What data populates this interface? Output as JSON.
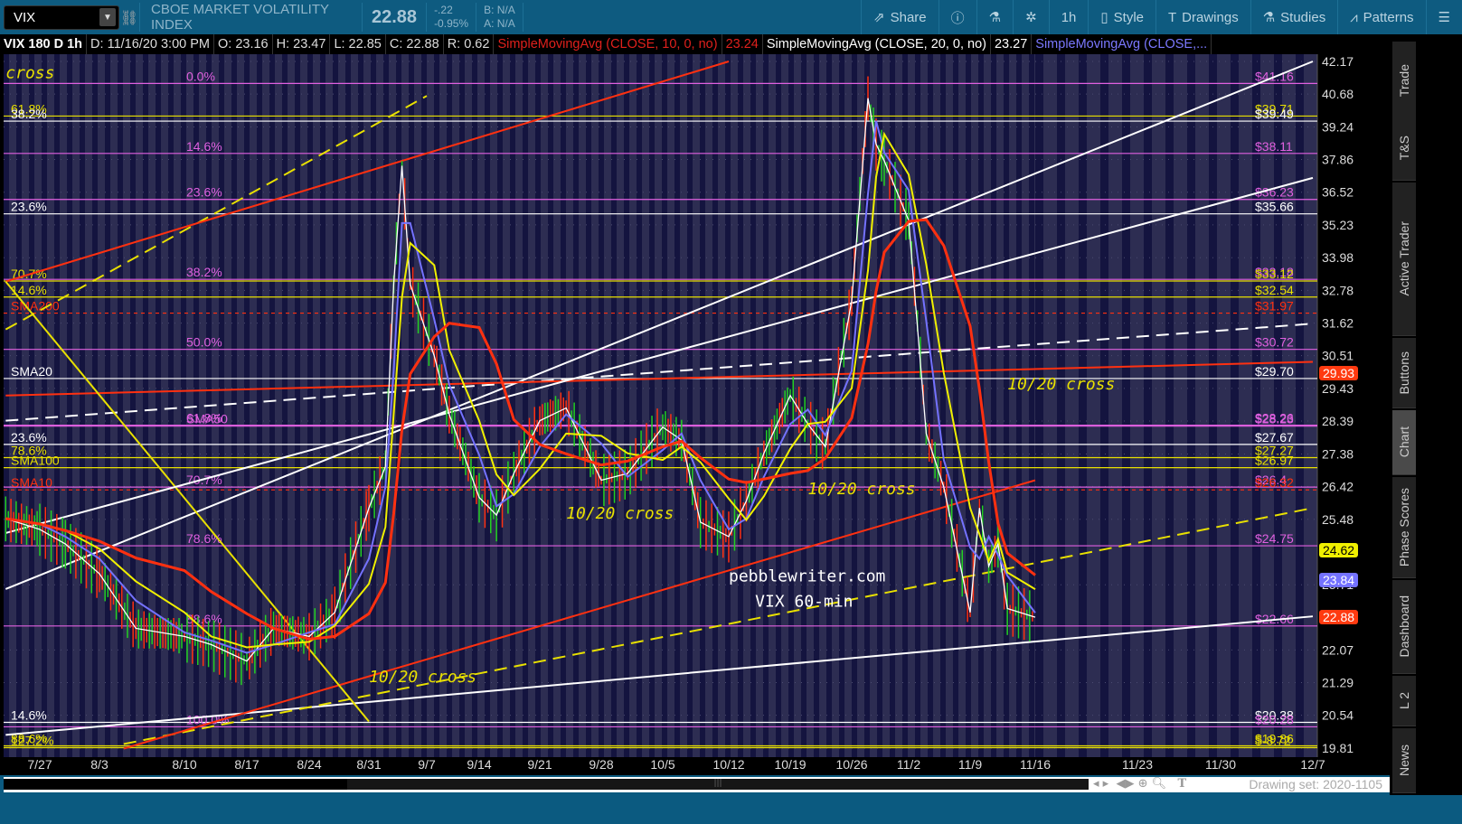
{
  "toolbar": {
    "symbol": "VIX",
    "description": "CBOE MARKET VOLATILITY INDEX",
    "last": "22.88",
    "change": "-.22",
    "change_pct": "-0.95%",
    "bid": "B: N/A",
    "ask": "A: N/A",
    "buttons": [
      {
        "label": "Share",
        "icon": "share-icon"
      },
      {
        "label": "",
        "icon": "info-icon"
      },
      {
        "label": "",
        "icon": "flask-icon"
      },
      {
        "label": "",
        "icon": "gear-icon"
      },
      {
        "label": "1h",
        "icon": ""
      },
      {
        "label": "Style",
        "icon": "candle-icon"
      },
      {
        "label": "Drawings",
        "icon": "text-tool-icon"
      },
      {
        "label": "Studies",
        "icon": "flask-icon"
      },
      {
        "label": "Patterns",
        "icon": "patterns-icon"
      },
      {
        "label": "",
        "icon": "menu-icon"
      }
    ]
  },
  "header": {
    "title": "VIX 180 D 1h",
    "date": "D: 11/16/20 3:00 PM",
    "open": "O: 23.16",
    "high": "H: 23.47",
    "low": "L: 22.85",
    "close": "C: 22.88",
    "range": "R: 0.62",
    "studies": [
      {
        "name": "SimpleMovingAvg (CLOSE, 10, 0, no)",
        "value": "23.24",
        "color": "#e0201c"
      },
      {
        "name": "SimpleMovingAvg (CLOSE, 20, 0, no)",
        "value": "23.27",
        "color": "#ffffff"
      },
      {
        "name": "SimpleMovingAvg (CLOSE,...",
        "value": "",
        "color": "#7b78ff"
      }
    ]
  },
  "chart_data": {
    "type": "line",
    "scale": "log",
    "ylim": [
      19.81,
      42.17
    ],
    "yticks": [
      "42.17",
      "40.68",
      "39.24",
      "37.86",
      "36.52",
      "35.23",
      "33.98",
      "32.78",
      "31.62",
      "30.51",
      "29.43",
      "28.39",
      "27.38",
      "26.42",
      "25.48",
      "23.71",
      "22.07",
      "21.29",
      "20.54",
      "19.81"
    ],
    "xticks": [
      "7/27",
      "8/3",
      "8/10",
      "8/17",
      "8/24",
      "8/31",
      "9/7",
      "9/14",
      "9/21",
      "9/28",
      "10/5",
      "10/12",
      "10/19",
      "10/26",
      "11/2",
      "11/9",
      "11/16",
      "11/23",
      "11/30",
      "12/7"
    ],
    "price": [
      [
        "7/23",
        25.5
      ],
      [
        "7/27",
        25.2
      ],
      [
        "7/30",
        24.8
      ],
      [
        "8/3",
        24
      ],
      [
        "8/6",
        22.6
      ],
      [
        "8/10",
        22.4
      ],
      [
        "8/13",
        22.2
      ],
      [
        "8/17",
        21.8
      ],
      [
        "8/20",
        22.6
      ],
      [
        "8/24",
        22.4
      ],
      [
        "8/27",
        23
      ],
      [
        "8/31",
        25.8
      ],
      [
        "9/2",
        27
      ],
      [
        "9/3",
        33
      ],
      [
        "9/4",
        37.6
      ],
      [
        "9/5",
        33
      ],
      [
        "9/8",
        30.5
      ],
      [
        "9/10",
        28.6
      ],
      [
        "9/14",
        26.1
      ],
      [
        "9/16",
        25.6
      ],
      [
        "9/18",
        26.8
      ],
      [
        "9/21",
        28.4
      ],
      [
        "9/24",
        28.8
      ],
      [
        "9/28",
        26.6
      ],
      [
        "10/1",
        26.8
      ],
      [
        "10/5",
        28.2
      ],
      [
        "10/7",
        27.8
      ],
      [
        "10/9",
        25.4
      ],
      [
        "10/12",
        25
      ],
      [
        "10/14",
        26
      ],
      [
        "10/16",
        27.4
      ],
      [
        "10/19",
        29.2
      ],
      [
        "10/21",
        28.3
      ],
      [
        "10/23",
        27.6
      ],
      [
        "10/26",
        32.4
      ],
      [
        "10/28",
        40.5
      ],
      [
        "10/29",
        38.5
      ],
      [
        "10/30",
        37.8
      ],
      [
        "11/2",
        35.4
      ],
      [
        "11/4",
        28
      ],
      [
        "11/6",
        26.4
      ],
      [
        "11/9",
        23
      ],
      [
        "11/10",
        25.8
      ],
      [
        "11/11",
        24.2
      ],
      [
        "11/12",
        24.8
      ],
      [
        "11/13",
        23.1
      ],
      [
        "11/16",
        22.88
      ]
    ],
    "levels": [
      {
        "price": 41.16,
        "label": "$41.16",
        "left": "0.0%",
        "color": "#e060e0"
      },
      {
        "price": 39.71,
        "label": "$39.71",
        "left": "61.8%",
        "color": "#e8e000"
      },
      {
        "price": 39.49,
        "label": "$39.49",
        "left": "38.2%",
        "color": "#ffffff"
      },
      {
        "price": 38.11,
        "label": "$38.11",
        "left": "14.6%",
        "color": "#e060e0"
      },
      {
        "price": 36.23,
        "label": "$36.23",
        "left": "23.6%",
        "color": "#e060e0"
      },
      {
        "price": 35.66,
        "label": "$35.66",
        "left": "23.6%",
        "color": "#ffffff"
      },
      {
        "price": 33.18,
        "label": "$33.18",
        "left": "38.2%",
        "color": "#e060e0"
      },
      {
        "price": 33.12,
        "label": "$33.12",
        "left": "70.7%",
        "color": "#e8e000"
      },
      {
        "price": 32.54,
        "label": "$32.54",
        "left": "14.6%",
        "color": "#e8e000"
      },
      {
        "price": 31.97,
        "label": "$31.97",
        "left": "SMA200",
        "color": "#ff3010"
      },
      {
        "price": 30.72,
        "label": "$30.72",
        "left": "50.0%",
        "color": "#e060e0"
      },
      {
        "price": 29.75,
        "label": "$29.70",
        "left": "SMA20",
        "color": "#ffffff"
      },
      {
        "price": 28.26,
        "label": "$28.26",
        "left": "61.8%",
        "color": "#e060e0"
      },
      {
        "price": 28.23,
        "label": "$28.23",
        "left": "SMA50",
        "color": "#e060e0"
      },
      {
        "price": 27.67,
        "label": "$27.67",
        "left": "23.6%",
        "color": "#ffffff"
      },
      {
        "price": 27.27,
        "label": "$27.27",
        "left": "78.6%",
        "color": "#e8e000"
      },
      {
        "price": 26.97,
        "label": "$26.97",
        "left": "SMA100",
        "color": "#e8e000"
      },
      {
        "price": 26.4,
        "label": "$26.4",
        "left": "70.7%",
        "color": "#e060e0"
      },
      {
        "price": 26.32,
        "label": "$26.32",
        "left": "SMA10",
        "color": "#ff3010"
      },
      {
        "price": 24.75,
        "label": "$24.75",
        "left": "78.6%",
        "color": "#e060e0"
      },
      {
        "price": 22.66,
        "label": "$22.66",
        "left": "88.6%",
        "color": "#e060e0"
      },
      {
        "price": 20.38,
        "label": "$20.38",
        "left": "14.6%",
        "color": "#ffffff"
      },
      {
        "price": 20.28,
        "label": "$20.28",
        "left": "100.0%",
        "color": "#e060e0"
      },
      {
        "price": 19.86,
        "label": "$19.86",
        "left": "88.6%",
        "color": "#e8e000"
      },
      {
        "price": 19.82,
        "label": "$-8.72",
        "left": "127.2%",
        "color": "#e8e000"
      }
    ],
    "trendlines": [
      {
        "from": [
          "7/23",
          23.6
        ],
        "to": [
          "12/7",
          42.17
        ],
        "color": "#ffffff",
        "dash": false
      },
      {
        "from": [
          "7/23",
          20.1
        ],
        "to": [
          "12/7",
          22.9
        ],
        "color": "#ffffff",
        "dash": false
      },
      {
        "from": [
          "7/23",
          28.4
        ],
        "to": [
          "12/7",
          31.6
        ],
        "color": "#ffffff",
        "dash": true
      },
      {
        "from": [
          "8/5",
          19.9
        ],
        "to": [
          "12/7",
          25.8
        ],
        "color": "#e8e000",
        "dash": true
      },
      {
        "from": [
          "7/23",
          31.4
        ],
        "to": [
          "9/7",
          40.6
        ],
        "color": "#e8e000",
        "dash": true
      },
      {
        "from": [
          "7/23",
          33.1
        ],
        "to": [
          "10/12",
          42.17
        ],
        "color": "#ff3010",
        "dash": false
      },
      {
        "from": [
          "8/5",
          19.8
        ],
        "to": [
          "11/16",
          26.6
        ],
        "color": "#ff3010",
        "dash": false
      },
      {
        "from": [
          "7/23",
          29.2
        ],
        "to": [
          "12/7",
          30.3
        ],
        "color": "#ff3010",
        "dash": false
      },
      {
        "from": [
          "7/23",
          33.1
        ],
        "to": [
          "8/31",
          20.4
        ],
        "color": "#e8e000",
        "dash": false
      },
      {
        "from": [
          "7/23",
          25.1
        ],
        "to": [
          "12/7",
          37.1
        ],
        "color": "#ffffff",
        "dash": false
      }
    ],
    "price_badges": [
      {
        "value": "29.93",
        "bg": "#ff3a10",
        "fg": "#ffffff"
      },
      {
        "value": "24.62",
        "bg": "#f0f000",
        "fg": "#000000"
      },
      {
        "value": "23.84",
        "bg": "#7472ff",
        "fg": "#ffffff"
      },
      {
        "value": "22.88",
        "bg": "#ff3a10",
        "fg": "#ffffff"
      }
    ],
    "annotations": [
      {
        "text": "10/20 cross",
        "at": [
          "8/31",
          21.3
        ],
        "color": "#e8e000"
      },
      {
        "text": "10/20 cross",
        "at": [
          "9/24",
          25.5
        ],
        "color": "#e8e000"
      },
      {
        "text": "10/20 cross",
        "at": [
          "10/21",
          26.2
        ],
        "color": "#e8e000"
      },
      {
        "text": "10/20 cross",
        "at": [
          "11/13",
          29.4
        ],
        "color": "#e8e000"
      },
      {
        "text": "pebblewriter.com",
        "at": [
          "10/12",
          23.8
        ],
        "color": "#ffffff"
      },
      {
        "text": "VIX 60-min",
        "at": [
          "10/15",
          23.15
        ],
        "color": "#ffffff"
      },
      {
        "text": "cross",
        "at": [
          "7/23",
          41.4
        ],
        "color": "#e8e000"
      }
    ]
  },
  "bottom": {
    "drawing_set": "Drawing set: 2020-1105"
  },
  "sidebar": {
    "tabs": [
      "Trade",
      "T&S",
      "Active Trader",
      "Buttons",
      "Chart",
      "Phase Scores",
      "Dashboard",
      "L 2",
      "News"
    ],
    "active": "Chart"
  }
}
